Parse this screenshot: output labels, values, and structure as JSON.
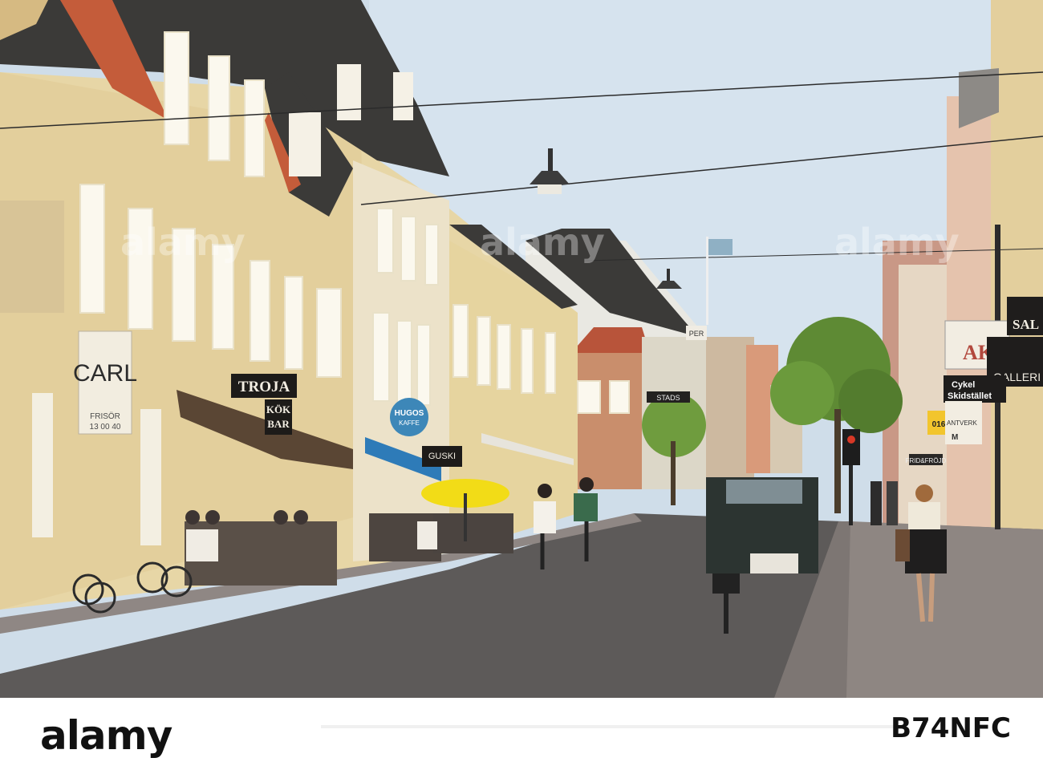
{
  "scene": {
    "colors": {
      "sky": "#cfdde9",
      "facade_yellow": "#e7d6a6",
      "roof_dark": "#3b3a38",
      "roof_tile": "#c45c3a",
      "road": "#5d5a59",
      "sidewalk": "#8f8784",
      "umbrella": "#f2dc17",
      "tree": "#5e8a34"
    },
    "signs": {
      "carl": "CARL",
      "carl_sub1": "FRISÖR",
      "carl_sub2": "13 00 40",
      "troja": "TROJA",
      "kok": "KÖK",
      "bar": "BAR",
      "hugos1": "HUGOS",
      "hugos2": "KAFFE",
      "guski": "GUSKI",
      "ak": "AK",
      "sal": "SAL",
      "galleri": "GALLERI",
      "cykel1": "Cykel",
      "cykel2": "Skidstället",
      "frid": "FRID&FRÖJD",
      "stads": "STADS",
      "per": "PER",
      "num": "016",
      "antverk": "ANTVERK",
      "m": "M"
    },
    "watermark": "alamy"
  },
  "footer": {
    "logo": "alamy",
    "image_id": "B74NFC"
  }
}
